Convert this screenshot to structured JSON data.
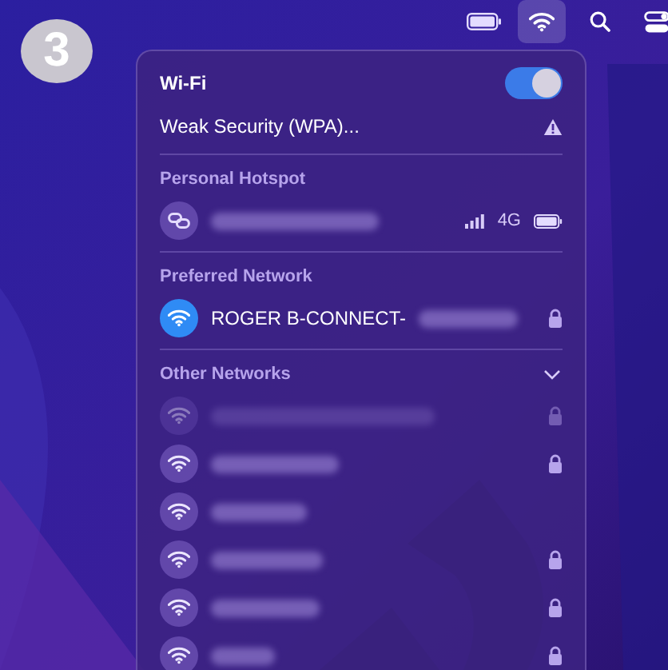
{
  "badge": "3",
  "menu_bar": {
    "wifi_active": true
  },
  "wifi": {
    "title": "Wi-Fi",
    "on": true,
    "warning": "Weak Security (WPA)..."
  },
  "hotspot": {
    "heading": "Personal Hotspot",
    "network_type": "4G"
  },
  "preferred": {
    "heading": "Preferred Network",
    "name": "ROGER B-CONNECT-",
    "connected": true,
    "locked": true
  },
  "other": {
    "heading": "Other Networks",
    "expanded": true,
    "networks": [
      {
        "locked": true,
        "dimmed": true
      },
      {
        "locked": true,
        "dimmed": false
      },
      {
        "locked": false,
        "dimmed": false
      },
      {
        "locked": true,
        "dimmed": false
      },
      {
        "locked": true,
        "dimmed": false
      },
      {
        "locked": true,
        "dimmed": false
      }
    ]
  }
}
